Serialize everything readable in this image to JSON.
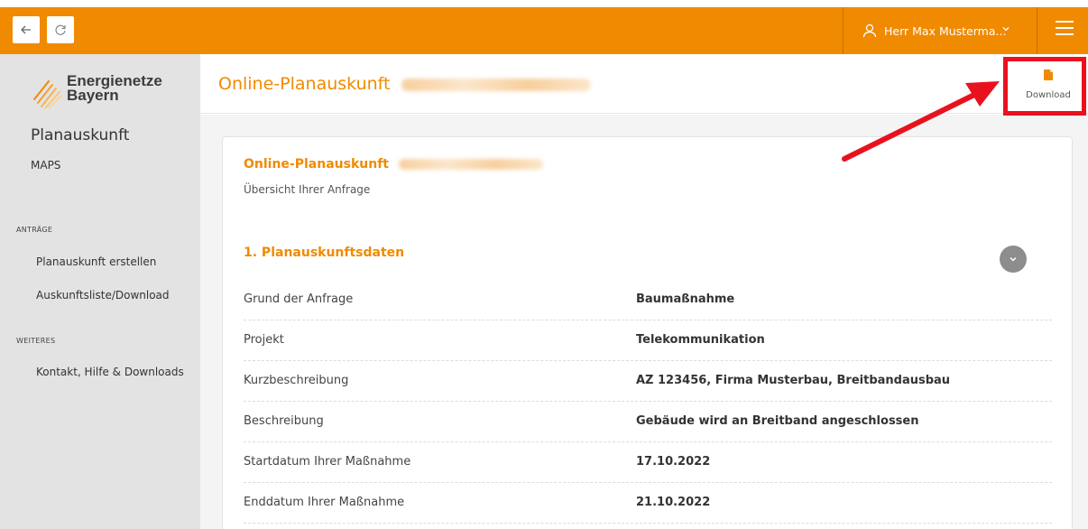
{
  "topbar": {
    "user_name": "Herr Max Musterma...",
    "accent": "#f08a00"
  },
  "sidebar": {
    "logo_line1": "Energienetze",
    "logo_line2": "Bayern",
    "title": "Planauskunft",
    "maps": "MAPS",
    "section_antraege": "ANTRÄGE",
    "link_create": "Planauskunft erstellen",
    "link_list": "Auskunftsliste/Download",
    "section_weiteres": "WEITERES",
    "link_contact": "Kontakt, Hilfe & Downloads"
  },
  "header": {
    "title": "Online-Planauskunft",
    "download_label": "Download"
  },
  "card": {
    "title": "Online-Planauskunft",
    "subtitle": "Übersicht Ihrer Anfrage",
    "section_title": "1. Planauskunftsdaten",
    "rows": [
      {
        "key": "Grund der Anfrage",
        "value": "Baumaßnahme"
      },
      {
        "key": "Projekt",
        "value": "Telekommunikation"
      },
      {
        "key": "Kurzbeschreibung",
        "value": "AZ 123456, Firma Musterbau, Breitbandausbau"
      },
      {
        "key": "Beschreibung",
        "value": "Gebäude wird an Breitband angeschlossen"
      },
      {
        "key": "Startdatum Ihrer Maßnahme",
        "value": "17.10.2022"
      },
      {
        "key": "Enddatum Ihrer Maßnahme",
        "value": "21.10.2022"
      }
    ]
  },
  "annotation_color": "#e8121e"
}
